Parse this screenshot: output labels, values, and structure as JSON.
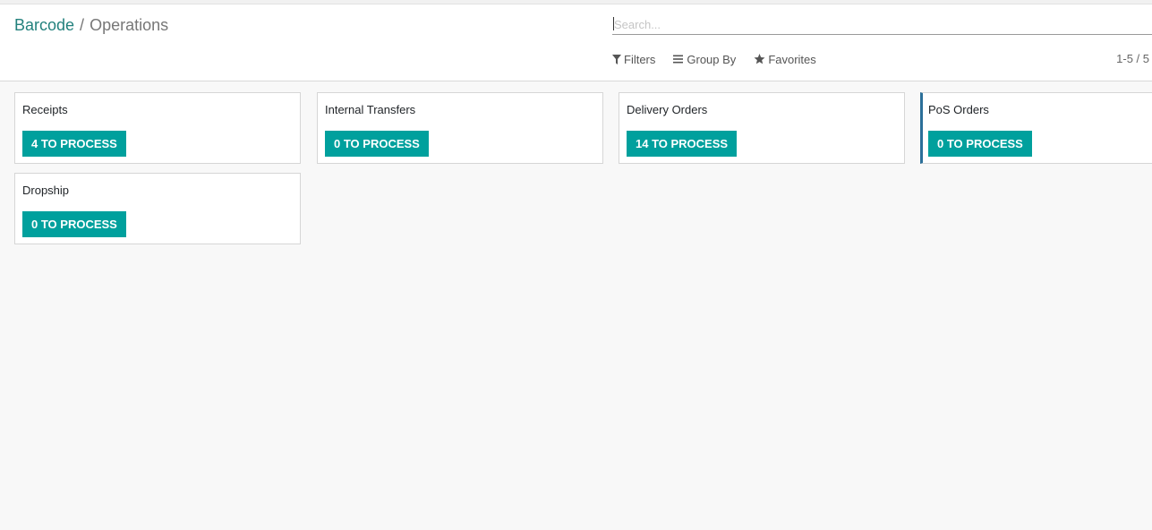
{
  "breadcrumb": {
    "parent": "Barcode",
    "separator": "/",
    "current": "Operations"
  },
  "search": {
    "placeholder": "Search...",
    "value": ""
  },
  "toolbar": {
    "filters_label": "Filters",
    "group_by_label": "Group By",
    "favorites_label": "Favorites",
    "filter_icon": "funnel-icon",
    "group_icon": "bars-icon",
    "favorites_icon": "star-icon"
  },
  "pager": {
    "text": "1-5 / 5"
  },
  "cards": [
    {
      "title": "Receipts",
      "button": "4 TO PROCESS"
    },
    {
      "title": "Internal Transfers",
      "button": "0 TO PROCESS"
    },
    {
      "title": "Delivery Orders",
      "button": "14 TO PROCESS"
    },
    {
      "title": "PoS Orders",
      "button": "0 TO PROCESS"
    },
    {
      "title": "Dropship",
      "button": "0 TO PROCESS"
    }
  ],
  "colors": {
    "accent": "#00a09d",
    "breadcrumb_link": "#23817d",
    "card_highlight_border": "#2b6f99"
  }
}
